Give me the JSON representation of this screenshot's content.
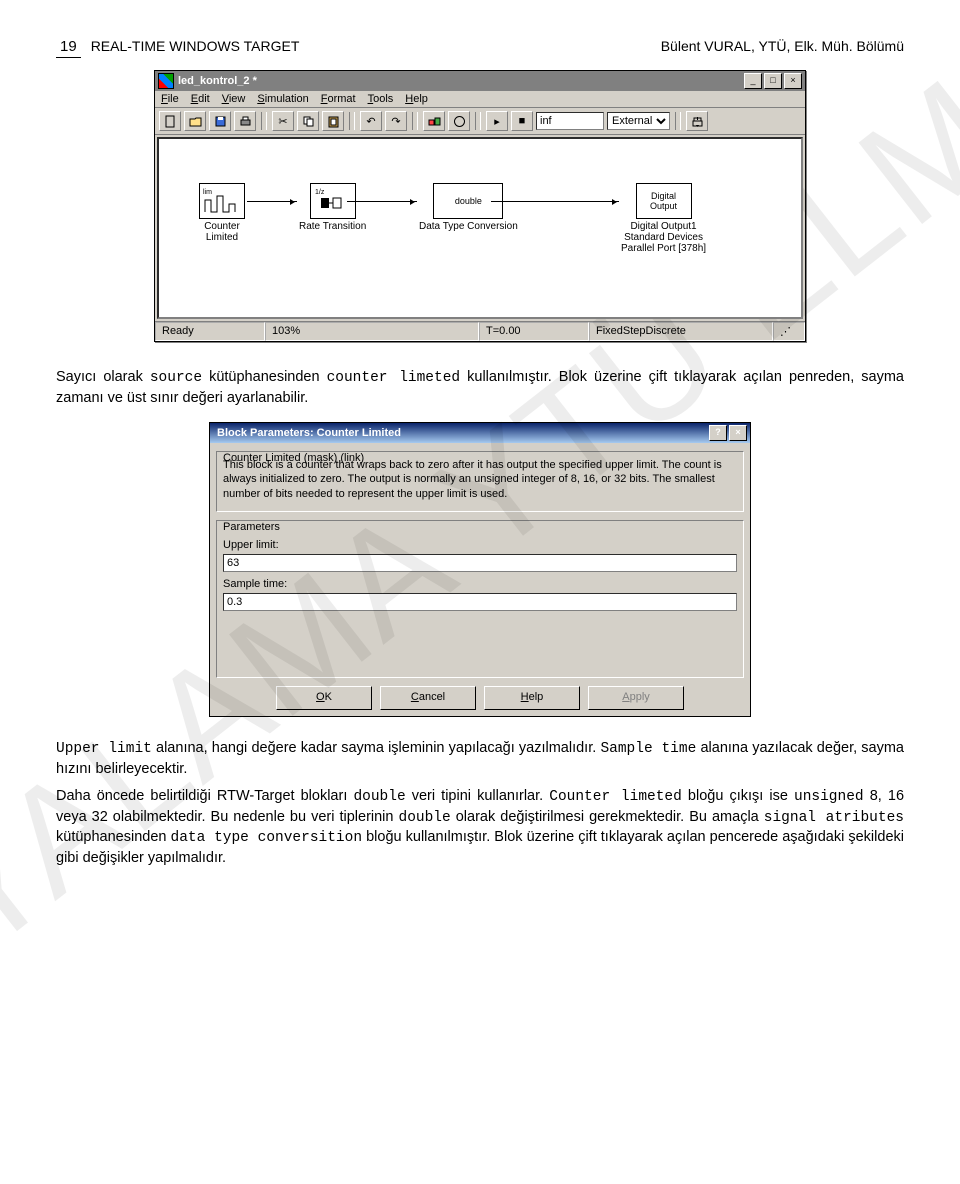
{
  "header": {
    "page_no": "19",
    "title_left": "REAL-TIME WINDOWS TARGET",
    "title_right": "Bülent VURAL, YTÜ, Elk. Müh. Bölümü"
  },
  "watermark": "KOPYALAMA YTÜ ELM BLM",
  "simwin": {
    "title": "led_kontrol_2 *",
    "menu": [
      "File",
      "Edit",
      "View",
      "Simulation",
      "Format",
      "Tools",
      "Help"
    ],
    "stoptime": "inf",
    "mode": "External",
    "status": {
      "ready": "Ready",
      "zoom": "103%",
      "time": "T=0.00",
      "solver": "FixedStepDiscrete"
    },
    "blocks": {
      "b1": {
        "label": "Counter\nLimited",
        "inner": "lim⌐z⌐"
      },
      "b2": {
        "label": "Rate Transition",
        "inner": "1/z"
      },
      "b3": {
        "label": "Data Type Conversion",
        "inner": "double"
      },
      "b4": {
        "label": "Digital Output1\nStandard Devices\nParallel Port [378h]",
        "inner": "Digital\nOutput"
      }
    }
  },
  "para1_a": "Sayıcı olarak ",
  "para1_b": "source",
  "para1_c": " kütüphanesinden ",
  "para1_d": "counter limeted",
  "para1_e": " kullanılmıştır. Blok üzerine çift tıklayarak açılan penreden, sayma zamanı ve üst sınır değeri ayarlanabilir.",
  "dialog": {
    "title": "Block Parameters: Counter Limited",
    "mask_legend": "Counter Limited (mask) (link)",
    "mask_desc": "This block is a counter that wraps back to zero after it has output the specified upper limit. The count is always initialized to zero. The output is normally an unsigned integer of 8, 16, or 32 bits. The smallest number of bits needed to represent the upper limit is used.",
    "param_legend": "Parameters",
    "upper_lbl": "Upper limit:",
    "upper_val": "63",
    "sample_lbl": "Sample time:",
    "sample_val": "0.3",
    "ok": "OK",
    "cancel": "Cancel",
    "help": "Help",
    "apply": "Apply"
  },
  "para2_a": "Upper limit",
  "para2_b": " alanına, hangi değere kadar sayma işleminin yapılacağı yazılmalıdır. ",
  "para2_c": "Sample time",
  "para2_d": "  alanına yazılacak değer, sayma hızını belirleyecektir.",
  "para3_a": "Daha öncede belirtildiği RTW-Target blokları ",
  "para3_b": "double",
  "para3_c": "  veri tipini kullanırlar. ",
  "para3_d": "Counter limeted",
  "para3_e": "  bloğu çıkışı ise ",
  "para3_f": "unsigned",
  "para3_g": "  8, 16 veya 32 olabilmektedir. Bu nedenle bu veri tiplerinin ",
  "para3_h": "double",
  "para3_i": " olarak değiştirilmesi gerekmektedir. Bu amaçla ",
  "para3_j": "signal atributes",
  "para3_k": " kütüphanesinden ",
  "para3_l": "data type conversition",
  "para3_m": " bloğu kullanılmıştır. Blok üzerine çift tıklayarak açılan pencerede aşağıdaki şekildeki gibi değişikler yapılmalıdır."
}
